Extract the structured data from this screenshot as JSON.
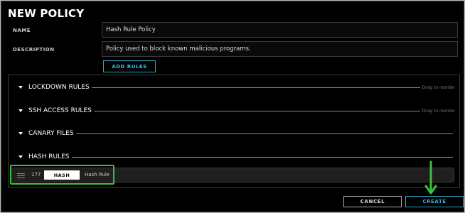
{
  "dialog": {
    "title": "NEW POLICY"
  },
  "form": {
    "name_label": "NAME",
    "name_value": "Hash Rule Policy",
    "description_label": "DESCRIPTION",
    "description_value": "Policy used to block known malicious programs.",
    "add_rules_label": "ADD RULES"
  },
  "sections": [
    {
      "label": "LOCKDOWN RULES",
      "hint": "Drag to reorder"
    },
    {
      "label": "SSH ACCESS RULES",
      "hint": "Drag to reorder"
    },
    {
      "label": "CANARY FILES",
      "hint": ""
    },
    {
      "label": "HASH RULES",
      "hint": ""
    }
  ],
  "hash_rule": {
    "id": "177",
    "type": "HASH",
    "name": "Hash Rule"
  },
  "buttons": {
    "cancel": "CANCEL",
    "create": "CREATE"
  },
  "colors": {
    "accent": "#2aa6c4",
    "highlight": "#39c13d",
    "background": "#000000"
  }
}
